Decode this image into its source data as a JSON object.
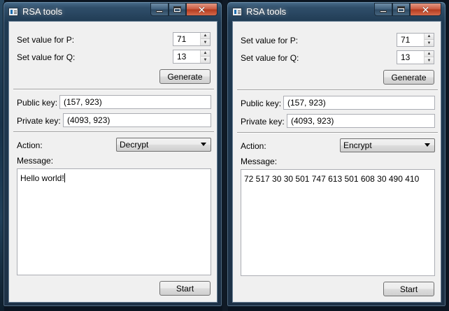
{
  "windows": [
    {
      "title": "RSA tools",
      "p_label": "Set value for P:",
      "p_value": "71",
      "q_label": "Set value for Q:",
      "q_value": "13",
      "generate_label": "Generate",
      "public_key_label": "Public key:",
      "public_key_value": "(157, 923)",
      "private_key_label": "Private key:",
      "private_key_value": "(4093, 923)",
      "action_label": "Action:",
      "action_value": "Decrypt",
      "message_label": "Message:",
      "message_value": "Hello world!",
      "start_label": "Start"
    },
    {
      "title": "RSA tools",
      "p_label": "Set value for P:",
      "p_value": "71",
      "q_label": "Set value for Q:",
      "q_value": "13",
      "generate_label": "Generate",
      "public_key_label": "Public key:",
      "public_key_value": "(157, 923)",
      "private_key_label": "Private key:",
      "private_key_value": "(4093, 923)",
      "action_label": "Action:",
      "action_value": "Encrypt",
      "message_label": "Message:",
      "message_value": "72 517 30 30 501 747 613 501 608 30 490 410",
      "start_label": "Start"
    }
  ],
  "icons": {
    "app": "rsa-app-icon",
    "minimize": "minimize-icon",
    "maximize": "maximize-icon",
    "close": "close-icon",
    "spin_up": "spin-up-arrow-icon",
    "spin_down": "spin-down-arrow-icon",
    "dropdown": "dropdown-arrow-icon"
  },
  "colors": {
    "titlebar": "#2f4e6a",
    "close_button": "#c9573d",
    "client_background": "#f0f0f0"
  }
}
